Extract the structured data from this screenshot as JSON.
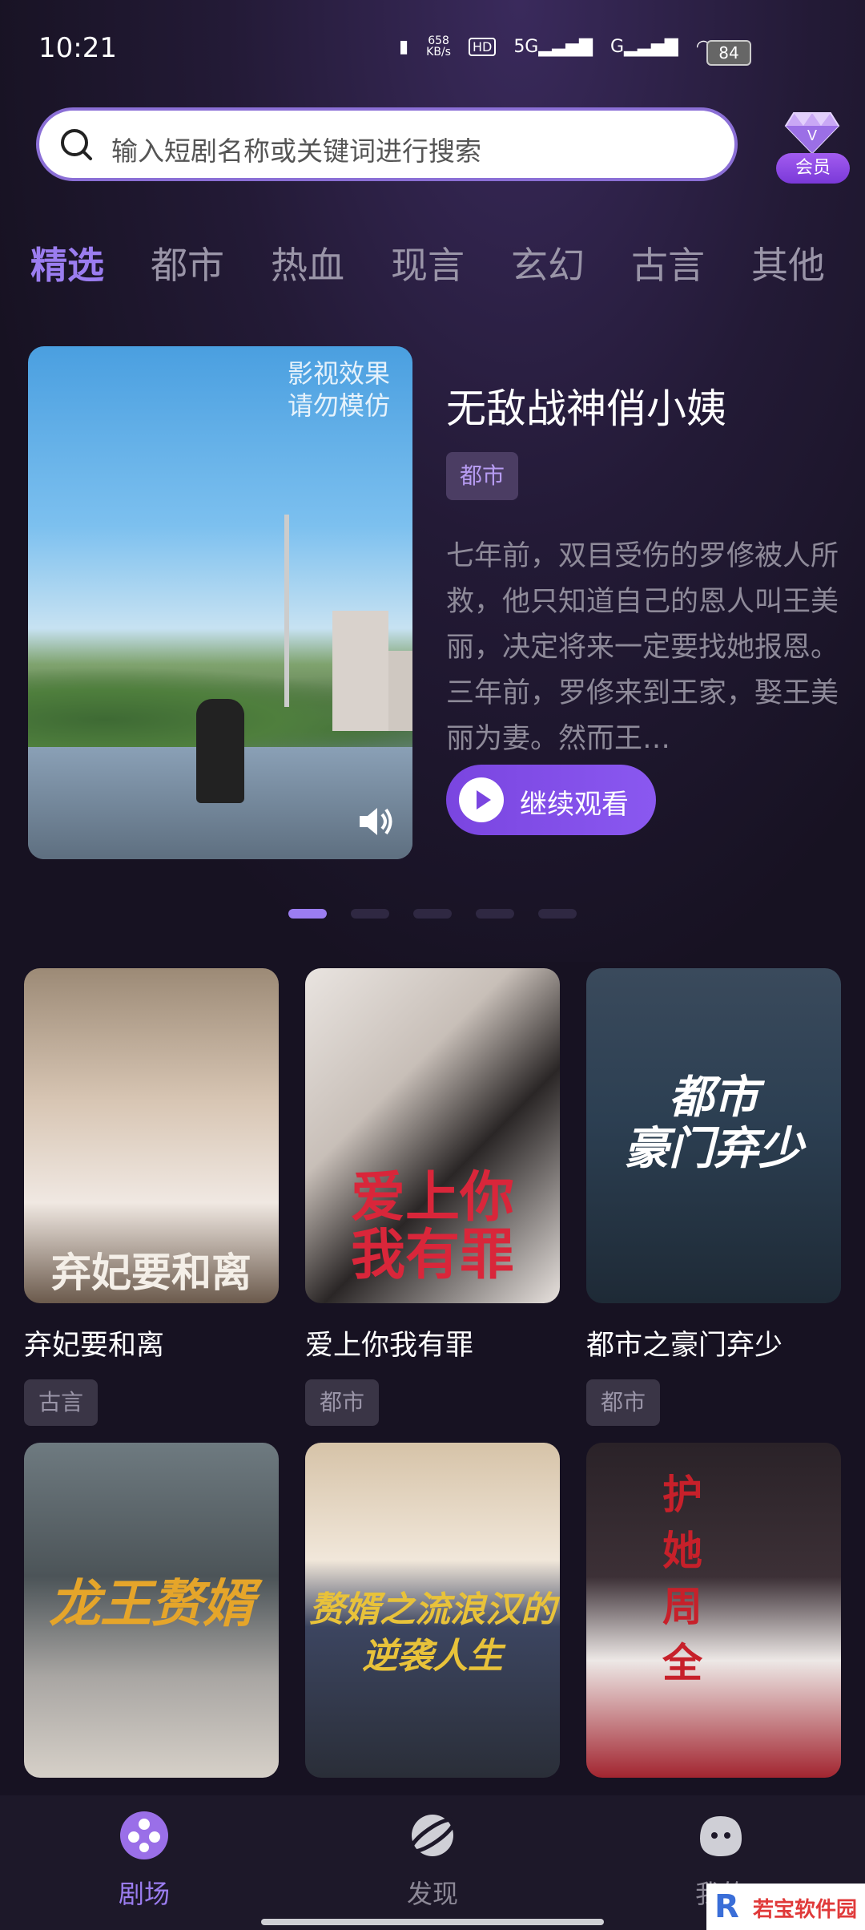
{
  "status_bar": {
    "time": "10:21",
    "net_speed": "658\nKB/s",
    "hd": "HD",
    "sim1": "5G",
    "sim2": "G",
    "battery": "84"
  },
  "search": {
    "placeholder": "输入短剧名称或关键词进行搜索"
  },
  "vip": {
    "label": "会员"
  },
  "tabs": [
    "精选",
    "都市",
    "热血",
    "现言",
    "玄幻",
    "古言",
    "其他"
  ],
  "hero": {
    "watermark_line1": "影视效果",
    "watermark_line2": "请勿模仿",
    "title": "无敌战神俏小姨",
    "tag": "都市",
    "description": "七年前，双目受伤的罗修被人所救，他只知道自己的恩人叫王美丽，决定将来一定要找她报恩。三年前，罗修来到王家，娶王美丽为妻。然而王…",
    "watch_label": "继续观看",
    "carousel_count": 5,
    "carousel_active": 1
  },
  "cards": [
    {
      "name": "弃妃要和离",
      "tag": "古言",
      "poster_text": "弃妃要和离",
      "accent": "#c9a98a"
    },
    {
      "name": "爱上你我有罪",
      "tag": "都市",
      "poster_text": "爱上你\n我有罪",
      "accent": "#d9263a"
    },
    {
      "name": "都市之豪门弃少",
      "tag": "都市",
      "poster_text": "都市\n豪门弃少",
      "accent": "#2c3f52"
    },
    {
      "name": "",
      "tag": "",
      "poster_text": "龙王赘婿",
      "accent": "#e5a52a"
    },
    {
      "name": "",
      "tag": "",
      "poster_text": "赘婿之流浪汉的\n逆袭人生",
      "accent": "#e8c23a"
    },
    {
      "name": "",
      "tag": "",
      "poster_text": "护她周全",
      "accent": "#c7202a"
    }
  ],
  "bottom_nav": {
    "items": [
      {
        "label": "剧场",
        "icon": "film-reel-icon",
        "active": true
      },
      {
        "label": "发现",
        "icon": "planet-icon",
        "active": false
      },
      {
        "label": "我的",
        "icon": "profile-face-icon",
        "active": false
      }
    ]
  },
  "watermark_logo": {
    "text": "若宝软件园"
  },
  "colors": {
    "accent": "#9b7df0",
    "button": "#7a45e0",
    "background": "#171222"
  }
}
